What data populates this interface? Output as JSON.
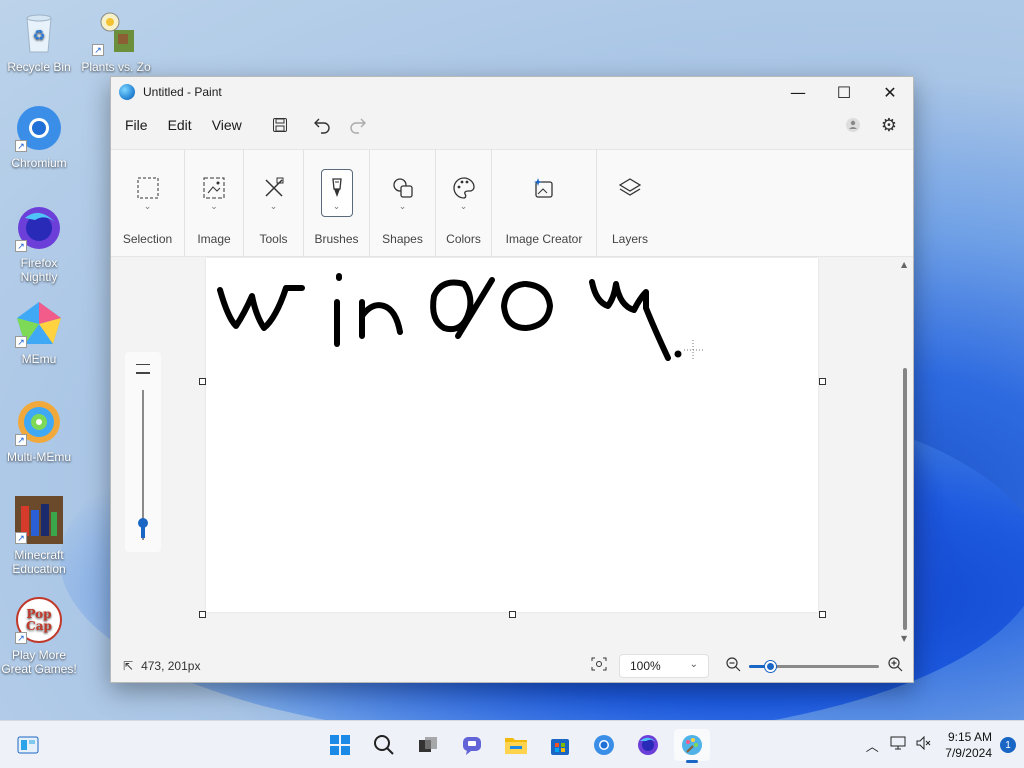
{
  "desktop": {
    "icons": [
      {
        "label": "Recycle Bin",
        "icon": "recycle-bin-icon"
      },
      {
        "label": "Plants vs. Zo",
        "icon": "plants-vs-zombies-icon"
      },
      {
        "label": "Chromium",
        "icon": "chromium-icon"
      },
      {
        "label": "Firefox Nightly",
        "icon": "firefox-nightly-icon"
      },
      {
        "label": "MEmu",
        "icon": "memu-icon"
      },
      {
        "label": "Multi-MEmu",
        "icon": "multi-memu-icon"
      },
      {
        "label": "Minecraft Education",
        "icon": "minecraft-education-icon"
      },
      {
        "label": "Play More Great Games!",
        "icon": "popcap-icon"
      }
    ]
  },
  "window": {
    "title": "Untitled - Paint",
    "controls": {
      "minimize": "—",
      "maximize": "☐",
      "close": "✕"
    }
  },
  "menubar": {
    "file": "File",
    "edit": "Edit",
    "view": "View"
  },
  "ribbon": {
    "groups": [
      {
        "label": "Selection",
        "icon": "selection-icon"
      },
      {
        "label": "Image",
        "icon": "image-icon"
      },
      {
        "label": "Tools",
        "icon": "tools-icon"
      },
      {
        "label": "Brushes",
        "icon": "brush-icon"
      },
      {
        "label": "Shapes",
        "icon": "shapes-icon"
      },
      {
        "label": "Colors",
        "icon": "palette-icon"
      },
      {
        "label": "Image Creator",
        "icon": "image-creator-icon"
      },
      {
        "label": "Layers",
        "icon": "layers-icon"
      }
    ]
  },
  "canvas": {
    "drawing": "handwritten-window-strokes",
    "stroke_color": "#000000"
  },
  "brush_size_slider": {
    "value_fraction": 0.1
  },
  "status": {
    "coordinates": "473, 201px",
    "zoom": "100%",
    "zoom_slider_fraction": 0.17
  },
  "taskbar": {
    "apps": [
      "widgets-icon",
      "start-icon",
      "search-icon",
      "task-view-icon",
      "chat-icon",
      "file-explorer-icon",
      "store-icon",
      "chromium-icon",
      "firefox-icon",
      "paint-icon"
    ],
    "active_app": "paint-icon",
    "time": "9:15 AM",
    "date": "7/9/2024",
    "notifications": "1"
  },
  "colors": {
    "accent": "#1a66c4",
    "window_bg": "#f3f3f3",
    "canvas_bg": "#ffffff"
  }
}
